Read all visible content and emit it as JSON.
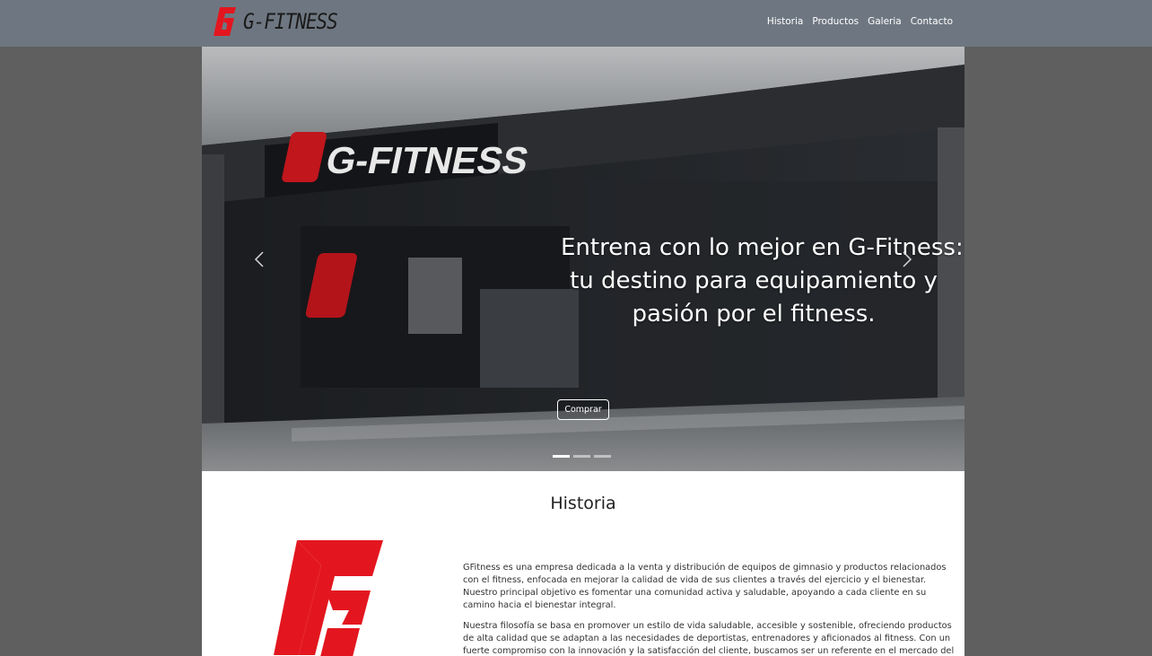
{
  "brand": {
    "name": "G-FITNESS",
    "logo_icon": "g-fitness-logo-icon",
    "accent": "#e3161f"
  },
  "nav": {
    "items": [
      {
        "label": "Historia"
      },
      {
        "label": "Productos"
      },
      {
        "label": "Galeria"
      },
      {
        "label": "Contacto"
      }
    ]
  },
  "hero": {
    "sign_text": "G-FITNESS",
    "caption_lines": [
      "Entrena con lo mejor en G-Fitness:",
      "tu destino para equipamiento y",
      "pasión por el fitness."
    ],
    "button_label": "Comprar",
    "prev_icon": "chevron-left-icon",
    "next_icon": "chevron-right-icon",
    "slides_count": 3,
    "active_slide": 1
  },
  "historia": {
    "title": "Historia",
    "paragraphs": [
      "GFitness es una empresa dedicada a la venta y distribución de equipos de gimnasio y productos relacionados con el fitness, enfocada en mejorar la calidad de vida de sus clientes a través del ejercicio y el bienestar. Nuestro principal objetivo es fomentar una comunidad activa y saludable, apoyando a cada cliente en su camino hacia el bienestar integral.",
      "Nuestra filosofía se basa en promover un estilo de vida saludable, accesible y sostenible, ofreciendo productos de alta calidad que se adaptan a las necesidades de deportistas, entrenadores y aficionados al fitness. Con un fuerte compromiso con la innovación y la satisfacción del cliente, buscamos ser un referente en el mercado del fitness, ayudando a nuestros usuarios a alcanzar sus metas físicas y de salud."
    ]
  }
}
